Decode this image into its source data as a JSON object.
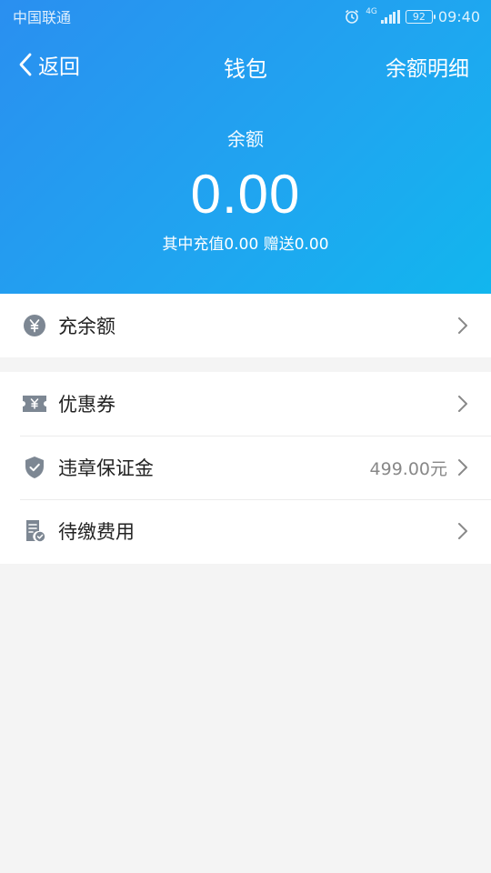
{
  "status_bar": {
    "carrier": "中国联通",
    "network": "4G",
    "battery": "92",
    "time": "09:40"
  },
  "nav": {
    "back_label": "返回",
    "title": "钱包",
    "right_label": "余额明细"
  },
  "balance": {
    "label": "余额",
    "amount": "0.00",
    "detail": "其中充值0.00 赠送0.00"
  },
  "menu_top": [
    {
      "label": "充余额",
      "icon": "yuan-coin-icon"
    }
  ],
  "menu_main": [
    {
      "label": "优惠券",
      "icon": "coupon-icon",
      "value": ""
    },
    {
      "label": "违章保证金",
      "icon": "shield-check-icon",
      "value": "499.00元"
    },
    {
      "label": "待缴费用",
      "icon": "bill-icon",
      "value": ""
    }
  ],
  "colors": {
    "header_start": "#2a8ff0",
    "header_end": "#12b6ee",
    "icon_gray": "#7d8793",
    "page_bg": "#f4f4f4"
  }
}
